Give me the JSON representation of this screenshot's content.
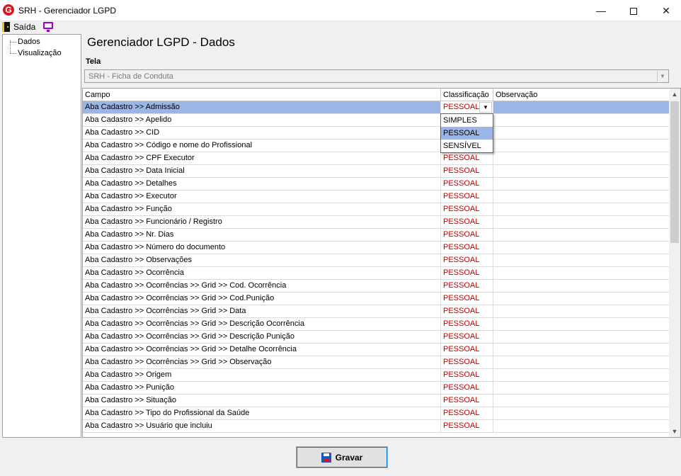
{
  "window": {
    "title": "SRH - Gerenciador LGPD",
    "icon_letter": "G"
  },
  "toolbar": {
    "exit_label": "Saída"
  },
  "tree": {
    "items": [
      "Dados",
      "Visualização"
    ]
  },
  "main": {
    "heading": "Gerenciador LGPD - Dados",
    "tela_label": "Tela",
    "tela_value": "SRH - Ficha de Conduta"
  },
  "grid": {
    "columns": [
      "Campo",
      "Classificação",
      "Observação"
    ],
    "rows": [
      {
        "campo": "Aba Cadastro >> Admissão",
        "classificacao": "PESSOAL",
        "observacao": ""
      },
      {
        "campo": "Aba Cadastro >> Apelido",
        "classificacao": "",
        "observacao": ""
      },
      {
        "campo": "Aba Cadastro >> CID",
        "classificacao": "",
        "observacao": ""
      },
      {
        "campo": "Aba Cadastro >> Código e nome do Profissional",
        "classificacao": "",
        "observacao": ""
      },
      {
        "campo": "Aba Cadastro >> CPF Executor",
        "classificacao": "PESSOAL",
        "observacao": ""
      },
      {
        "campo": "Aba Cadastro >> Data Inicial",
        "classificacao": "PESSOAL",
        "observacao": ""
      },
      {
        "campo": "Aba Cadastro >> Detalhes",
        "classificacao": "PESSOAL",
        "observacao": ""
      },
      {
        "campo": "Aba Cadastro >> Executor",
        "classificacao": "PESSOAL",
        "observacao": ""
      },
      {
        "campo": "Aba Cadastro >> Função",
        "classificacao": "PESSOAL",
        "observacao": ""
      },
      {
        "campo": "Aba Cadastro >> Funcionário / Registro",
        "classificacao": "PESSOAL",
        "observacao": ""
      },
      {
        "campo": "Aba Cadastro >> Nr. Dias",
        "classificacao": "PESSOAL",
        "observacao": ""
      },
      {
        "campo": "Aba Cadastro >> Número do documento",
        "classificacao": "PESSOAL",
        "observacao": ""
      },
      {
        "campo": "Aba Cadastro >> Observações",
        "classificacao": "PESSOAL",
        "observacao": ""
      },
      {
        "campo": "Aba Cadastro >> Ocorrência",
        "classificacao": "PESSOAL",
        "observacao": ""
      },
      {
        "campo": "Aba Cadastro >> Ocorrências >> Grid >> Cod. Ocorrência",
        "classificacao": "PESSOAL",
        "observacao": ""
      },
      {
        "campo": "Aba Cadastro >> Ocorrências >> Grid >> Cod.Punição",
        "classificacao": "PESSOAL",
        "observacao": ""
      },
      {
        "campo": "Aba Cadastro >> Ocorrências >> Grid >> Data",
        "classificacao": "PESSOAL",
        "observacao": ""
      },
      {
        "campo": "Aba Cadastro >> Ocorrências >> Grid >> Descrição Ocorrência",
        "classificacao": "PESSOAL",
        "observacao": ""
      },
      {
        "campo": "Aba Cadastro >> Ocorrências >> Grid >> Descrição Punição",
        "classificacao": "PESSOAL",
        "observacao": ""
      },
      {
        "campo": "Aba Cadastro >> Ocorrências >> Grid >> Detalhe Ocorrência",
        "classificacao": "PESSOAL",
        "observacao": ""
      },
      {
        "campo": "Aba Cadastro >> Ocorrências >> Grid >> Observação",
        "classificacao": "PESSOAL",
        "observacao": ""
      },
      {
        "campo": "Aba Cadastro >> Origem",
        "classificacao": "PESSOAL",
        "observacao": ""
      },
      {
        "campo": "Aba Cadastro >> Punição",
        "classificacao": "PESSOAL",
        "observacao": ""
      },
      {
        "campo": "Aba Cadastro >> Situação",
        "classificacao": "PESSOAL",
        "observacao": ""
      },
      {
        "campo": "Aba Cadastro >> Tipo do Profissional da Saúde",
        "classificacao": "PESSOAL",
        "observacao": ""
      },
      {
        "campo": "Aba Cadastro >> Usuário que incluiu",
        "classificacao": "PESSOAL",
        "observacao": ""
      }
    ]
  },
  "dropdown": {
    "options": [
      "SIMPLES",
      "PESSOAL",
      "SENSÍVEL"
    ],
    "highlighted_index": 1
  },
  "buttons": {
    "save_label": "Gravar"
  },
  "colors": {
    "selected_row": "#9bb5e6",
    "classification_text": "#c00000",
    "accent": "#0078d7"
  }
}
